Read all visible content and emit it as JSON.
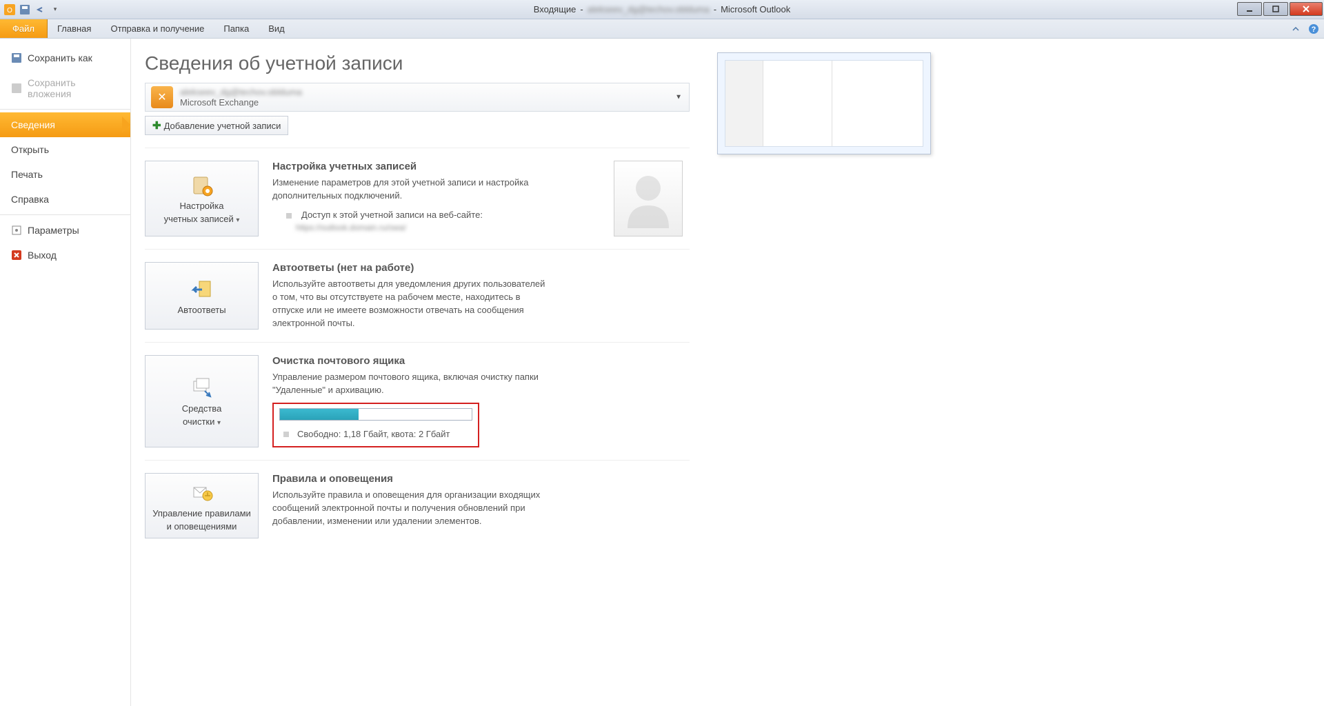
{
  "titlebar": {
    "inbox_label": "Входящие",
    "account_blur": "alekseev_dg@techov.oblduma",
    "app_name": "Microsoft Outlook"
  },
  "ribbon": {
    "file": "Файл",
    "tabs": [
      "Главная",
      "Отправка и получение",
      "Папка",
      "Вид"
    ]
  },
  "sidebar": {
    "save_as": "Сохранить как",
    "save_attachments": "Сохранить вложения",
    "info": "Сведения",
    "open": "Открыть",
    "print": "Печать",
    "help": "Справка",
    "options": "Параметры",
    "exit": "Выход"
  },
  "main": {
    "title": "Сведения об учетной записи",
    "account_email_blur": "alekseev_dg@techov.oblduma",
    "account_type": "Microsoft Exchange",
    "add_account": "Добавление учетной записи",
    "sections": {
      "settings": {
        "btn_line1": "Настройка",
        "btn_line2": "учетных записей",
        "title": "Настройка учетных записей",
        "desc": "Изменение параметров для этой учетной записи и настройка дополнительных подключений.",
        "bullet": "Доступ к этой учетной записи на веб-сайте:",
        "link_blur": "https://outlook.domain.ru/owa/"
      },
      "autoreply": {
        "btn": "Автоответы",
        "title": "Автоответы (нет на работе)",
        "desc": "Используйте автоответы для уведомления других пользователей о том, что вы отсутствуете на рабочем месте, находитесь в отпуске или не имеете возможности отвечать на сообщения электронной почты."
      },
      "cleanup": {
        "btn_line1": "Средства",
        "btn_line2": "очистки",
        "title": "Очистка почтового ящика",
        "desc": "Управление размером почтового ящика, включая очистку папки \"Удаленные\" и архивацию.",
        "quota_text": "Свободно: 1,18 Гбайт, квота: 2 Гбайт",
        "quota_fill_percent": 41
      },
      "rules": {
        "btn_line1": "Управление правилами",
        "btn_line2": "и оповещениями",
        "title": "Правила и оповещения",
        "desc": "Используйте правила и оповещения для организации входящих сообщений электронной почты и получения обновлений при добавлении, изменении или удалении элементов."
      }
    }
  }
}
